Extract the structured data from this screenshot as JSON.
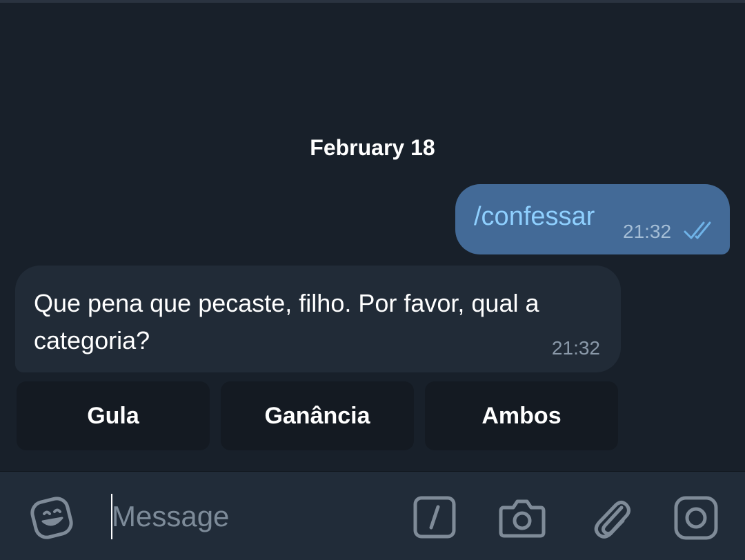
{
  "chat": {
    "date_header": "February 18",
    "outgoing": {
      "text": "/confessar",
      "time": "21:32",
      "status_icon": "double-check-icon"
    },
    "incoming": {
      "text": "Que pena que pecaste, filho. Por favor, qual a categoria?",
      "time": "21:32"
    },
    "inline_keyboard": [
      {
        "label": "Gula"
      },
      {
        "label": "Ganância"
      },
      {
        "label": "Ambos"
      }
    ]
  },
  "composer": {
    "placeholder": "Message",
    "value": "",
    "icons": [
      "emoji-icon",
      "bot-command-icon",
      "camera-icon",
      "attach-icon",
      "record-icon"
    ]
  },
  "colors": {
    "background": "#18202a",
    "outgoing_bubble": "#436a97",
    "incoming_bubble": "#212b37",
    "command_link": "#8fd0ff",
    "input_bar": "#212c39",
    "icon": "#7f8b98"
  }
}
